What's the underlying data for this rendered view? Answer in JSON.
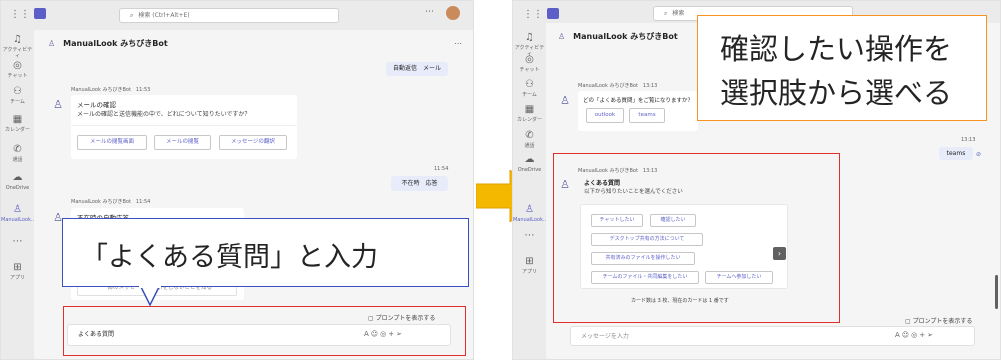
{
  "left": {
    "search_placeholder": "検索 (Ctrl+Alt+E)",
    "bot_name": "ManualLook みちびきBot",
    "rail": [
      "アクティビティ",
      "チャット",
      "チーム",
      "カレンダー",
      "通話",
      "OneDrive",
      "ManualLook...",
      "",
      "アプリ"
    ],
    "auto_reply_bubble": "自動返信　メール",
    "msg1_meta": "ManualLook みちびきBot　11:53",
    "msg1_title": "メールの確認",
    "msg1_text": "メールの確認と送信機能の中で、どれについて知りたいですか？",
    "msg1_buttons": [
      "メールの閲覧画面",
      "メールの閲覧",
      "メッセージの翻訳"
    ],
    "time_1154": "11:54",
    "absent_bubble": "不在時　応答",
    "msg2_meta": "ManualLook みちびきBot　11:54",
    "msg2_title": "不在時の自動応答",
    "hidden_button_text": "一部のメッセージの表示をしないことを知る",
    "callout_text": "「よくある質問」と入力",
    "prompt_hint": "プロンプトを表示する",
    "compose_value": "よくある質問"
  },
  "right": {
    "search_placeholder": "検索",
    "bot_name": "ManualLook みちびきBot",
    "rail": [
      "アクティビティ",
      "チャット",
      "チーム",
      "カレンダー",
      "通話",
      "OneDrive",
      "ManualLook...",
      "",
      "アプリ"
    ],
    "callout_line1": "確認したい操作を",
    "callout_line2": "選択肢から選べる",
    "msg1_meta": "ManualLook みちびきBot　13:13",
    "msg1_text": "どの「よくある質問」をご覧になりますか？",
    "msg1_buttons": [
      "outlook",
      "teams"
    ],
    "time_1313": "13:13",
    "teams_bubble": "teams",
    "msg2_meta": "ManualLook みちびきBot　13:13",
    "msg2_title": "よくある質問",
    "msg2_text": "以下から知りたいことを選んでください",
    "faq_buttons": [
      "チャットしたい",
      "確認したい",
      "デスクトップ共有の方法について",
      "共有済みのファイルを操作したい",
      "チームのファイル・共同編集をしたい",
      "チームへ参加したい"
    ],
    "carousel_text": "カード数は 3 枚、現在のカードは 1 番です",
    "prompt_hint": "プロンプトを表示する",
    "compose_placeholder": "メッセージを入力"
  },
  "colors": {
    "accent": "#5b5fc7",
    "highlight_red": "#e0302c",
    "callout_blue": "#3a4fc0",
    "orange": "#f7931e",
    "arrow": "#f5b800"
  }
}
